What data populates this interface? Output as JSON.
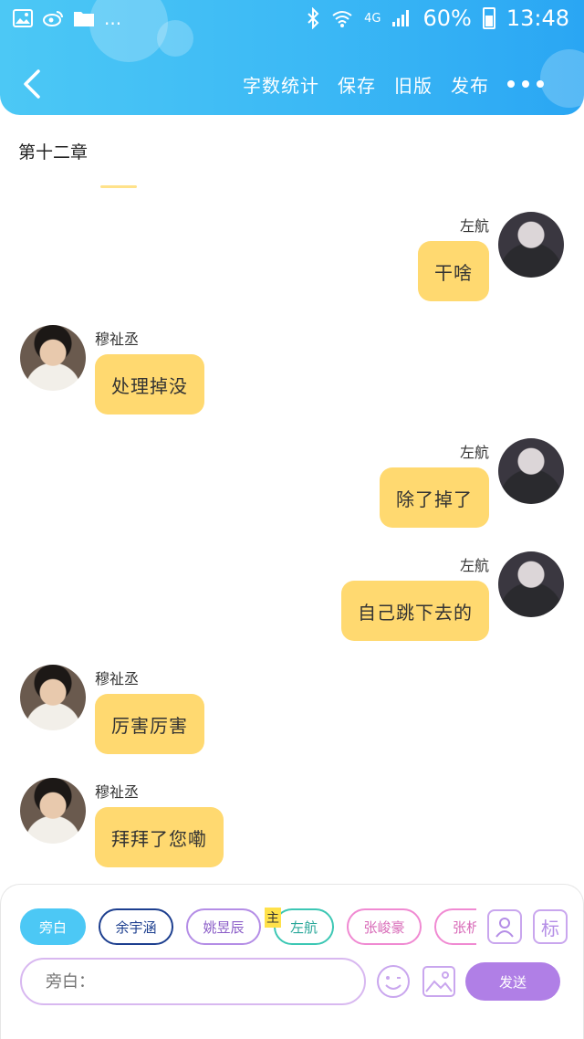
{
  "status_bar": {
    "dots": "...",
    "network": "4G",
    "battery": "60%",
    "time": "13:48"
  },
  "header": {
    "actions": [
      "字数统计",
      "保存",
      "旧版",
      "发布"
    ]
  },
  "chapter": {
    "title": "第十二章"
  },
  "messages": [
    {
      "side": "right",
      "name": "左航",
      "text": "干啥"
    },
    {
      "side": "left",
      "name": "穆祉丞",
      "text": "处理掉没"
    },
    {
      "side": "right",
      "name": "左航",
      "text": "除了掉了"
    },
    {
      "side": "right",
      "name": "左航",
      "text": "自己跳下去的"
    },
    {
      "side": "left",
      "name": "穆祉丞",
      "text": "厉害厉害"
    },
    {
      "side": "left",
      "name": "穆祉丞",
      "text": "拜拜了您嘞"
    }
  ],
  "composer": {
    "roles": [
      {
        "label": "旁白",
        "active": true,
        "color": "#4cc8f5"
      },
      {
        "label": "余宇涵",
        "active": false,
        "color": "#1d3f8f"
      },
      {
        "label": "姚昱辰",
        "active": false,
        "color": "#b48de6"
      },
      {
        "label": "左航",
        "active": false,
        "color": "#3cc7b4"
      },
      {
        "label": "张峻豪",
        "active": false,
        "color": "#f08ad2"
      },
      {
        "label": "张析",
        "active": false,
        "color": "#f08ad2"
      }
    ],
    "zhu_tag": "主",
    "biao_label": "标",
    "input_placeholder": "旁白：",
    "send_label": "发送"
  },
  "colors": {
    "header": "#3bb8f5",
    "bubble": "#ffd970",
    "send": "#b07fe6"
  }
}
